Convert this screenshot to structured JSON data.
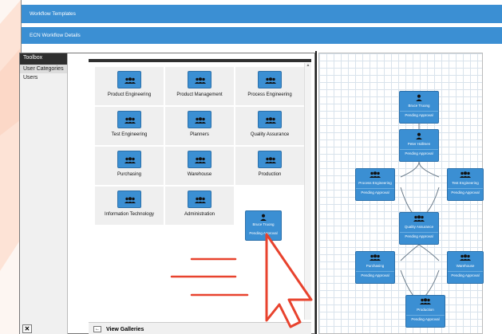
{
  "header": {
    "title": "Workflow Templates",
    "subtitle": "ECN Workflow Details"
  },
  "toolbox": {
    "title": "Toolbox",
    "items": [
      "User Categories",
      "Users"
    ],
    "close_symbol": "✕"
  },
  "gallery": {
    "tiles": [
      {
        "label": "Product Engineering",
        "icon": "group-icon"
      },
      {
        "label": "Product Management",
        "icon": "group-icon"
      },
      {
        "label": "Process Engineering",
        "icon": "group-icon"
      },
      {
        "label": "Test Engineering",
        "icon": "group-icon"
      },
      {
        "label": "Planners",
        "icon": "group-icon"
      },
      {
        "label": "Quality Assurance",
        "icon": "group-icon"
      },
      {
        "label": "Purchasing",
        "icon": "group-icon"
      },
      {
        "label": "Warehouse",
        "icon": "group-icon"
      },
      {
        "label": "Production",
        "icon": "group-icon"
      },
      {
        "label": "Information Technology",
        "icon": "group-icon"
      },
      {
        "label": "Administration",
        "icon": "group-icon"
      }
    ],
    "view_galleries": "View Galleries",
    "back_symbol": "←"
  },
  "drag_card": {
    "name": "Bruce Truong",
    "status": "Pending Approval"
  },
  "workflow": {
    "nodes": [
      {
        "name": "Bruce Truong",
        "status": "Pending Approval",
        "icon": "user-icon"
      },
      {
        "name": "Peter Hollmen",
        "status": "Pending Approval",
        "icon": "user-icon"
      },
      {
        "name": "Process Engineering",
        "status": "Pending Approval",
        "icon": "group-icon"
      },
      {
        "name": "Test Engineering",
        "status": "Pending Approval",
        "icon": "group-icon"
      },
      {
        "name": "Quality Assurance",
        "status": "Pending Approval",
        "icon": "group-icon"
      },
      {
        "name": "Purchasing",
        "status": "Pending Approval",
        "icon": "group-icon"
      },
      {
        "name": "Warehouse",
        "status": "Pending Approval",
        "icon": "group-icon"
      },
      {
        "name": "Production",
        "status": "Pending Approval",
        "icon": "group-icon"
      }
    ]
  },
  "colors": {
    "accent": "#3b8fd3",
    "arrow": "#e8432e"
  }
}
